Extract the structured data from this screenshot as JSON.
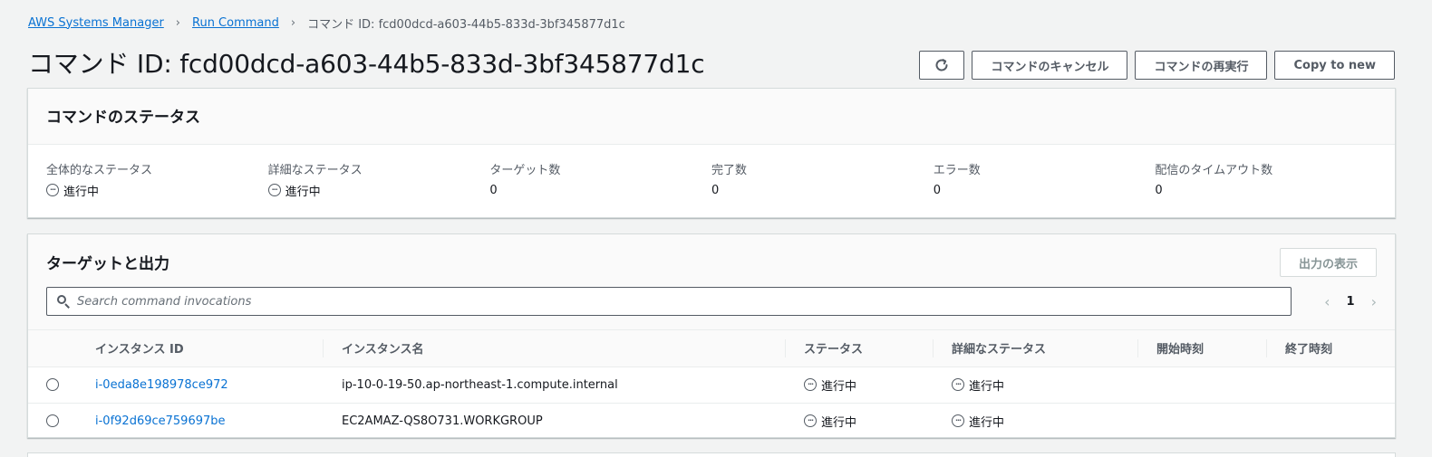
{
  "breadcrumb": {
    "root": "AWS Systems Manager",
    "parent": "Run Command",
    "current": "コマンド ID: fcd00dcd-a603-44b5-833d-3bf345877d1c"
  },
  "header": {
    "title": "コマンド ID: fcd00dcd-a603-44b5-833d-3bf345877d1c",
    "cancel_label": "コマンドのキャンセル",
    "rerun_label": "コマンドの再実行",
    "copy_label": "Copy to new"
  },
  "status_panel": {
    "title": "コマンドのステータス",
    "overall_label": "全体的なステータス",
    "overall_value": "進行中",
    "detail_label": "詳細なステータス",
    "detail_value": "進行中",
    "targets_label": "ターゲット数",
    "targets_value": "0",
    "completed_label": "完了数",
    "completed_value": "0",
    "errors_label": "エラー数",
    "errors_value": "0",
    "timeouts_label": "配信のタイムアウト数",
    "timeouts_value": "0"
  },
  "targets_panel": {
    "title": "ターゲットと出力",
    "output_label": "出力の表示",
    "search_placeholder": "Search command invocations",
    "page": "1",
    "columns": {
      "instance_id": "インスタンス ID",
      "instance_name": "インスタンス名",
      "status": "ステータス",
      "detail_status": "詳細なステータス",
      "start_time": "開始時刻",
      "end_time": "終了時刻"
    },
    "rows": [
      {
        "instance_id": "i-0eda8e198978ce972",
        "instance_name": "ip-10-0-19-50.ap-northeast-1.compute.internal",
        "status": "進行中",
        "detail_status": "進行中",
        "start_time": "",
        "end_time": ""
      },
      {
        "instance_id": "i-0f92d69ce759697be",
        "instance_name": "EC2AMAZ-QS8O731.WORKGROUP",
        "status": "進行中",
        "detail_status": "進行中",
        "start_time": "",
        "end_time": ""
      }
    ]
  },
  "colors": {
    "link": "#0972d3",
    "text": "#16191f",
    "muted": "#545b64",
    "background": "#f2f3f3"
  }
}
